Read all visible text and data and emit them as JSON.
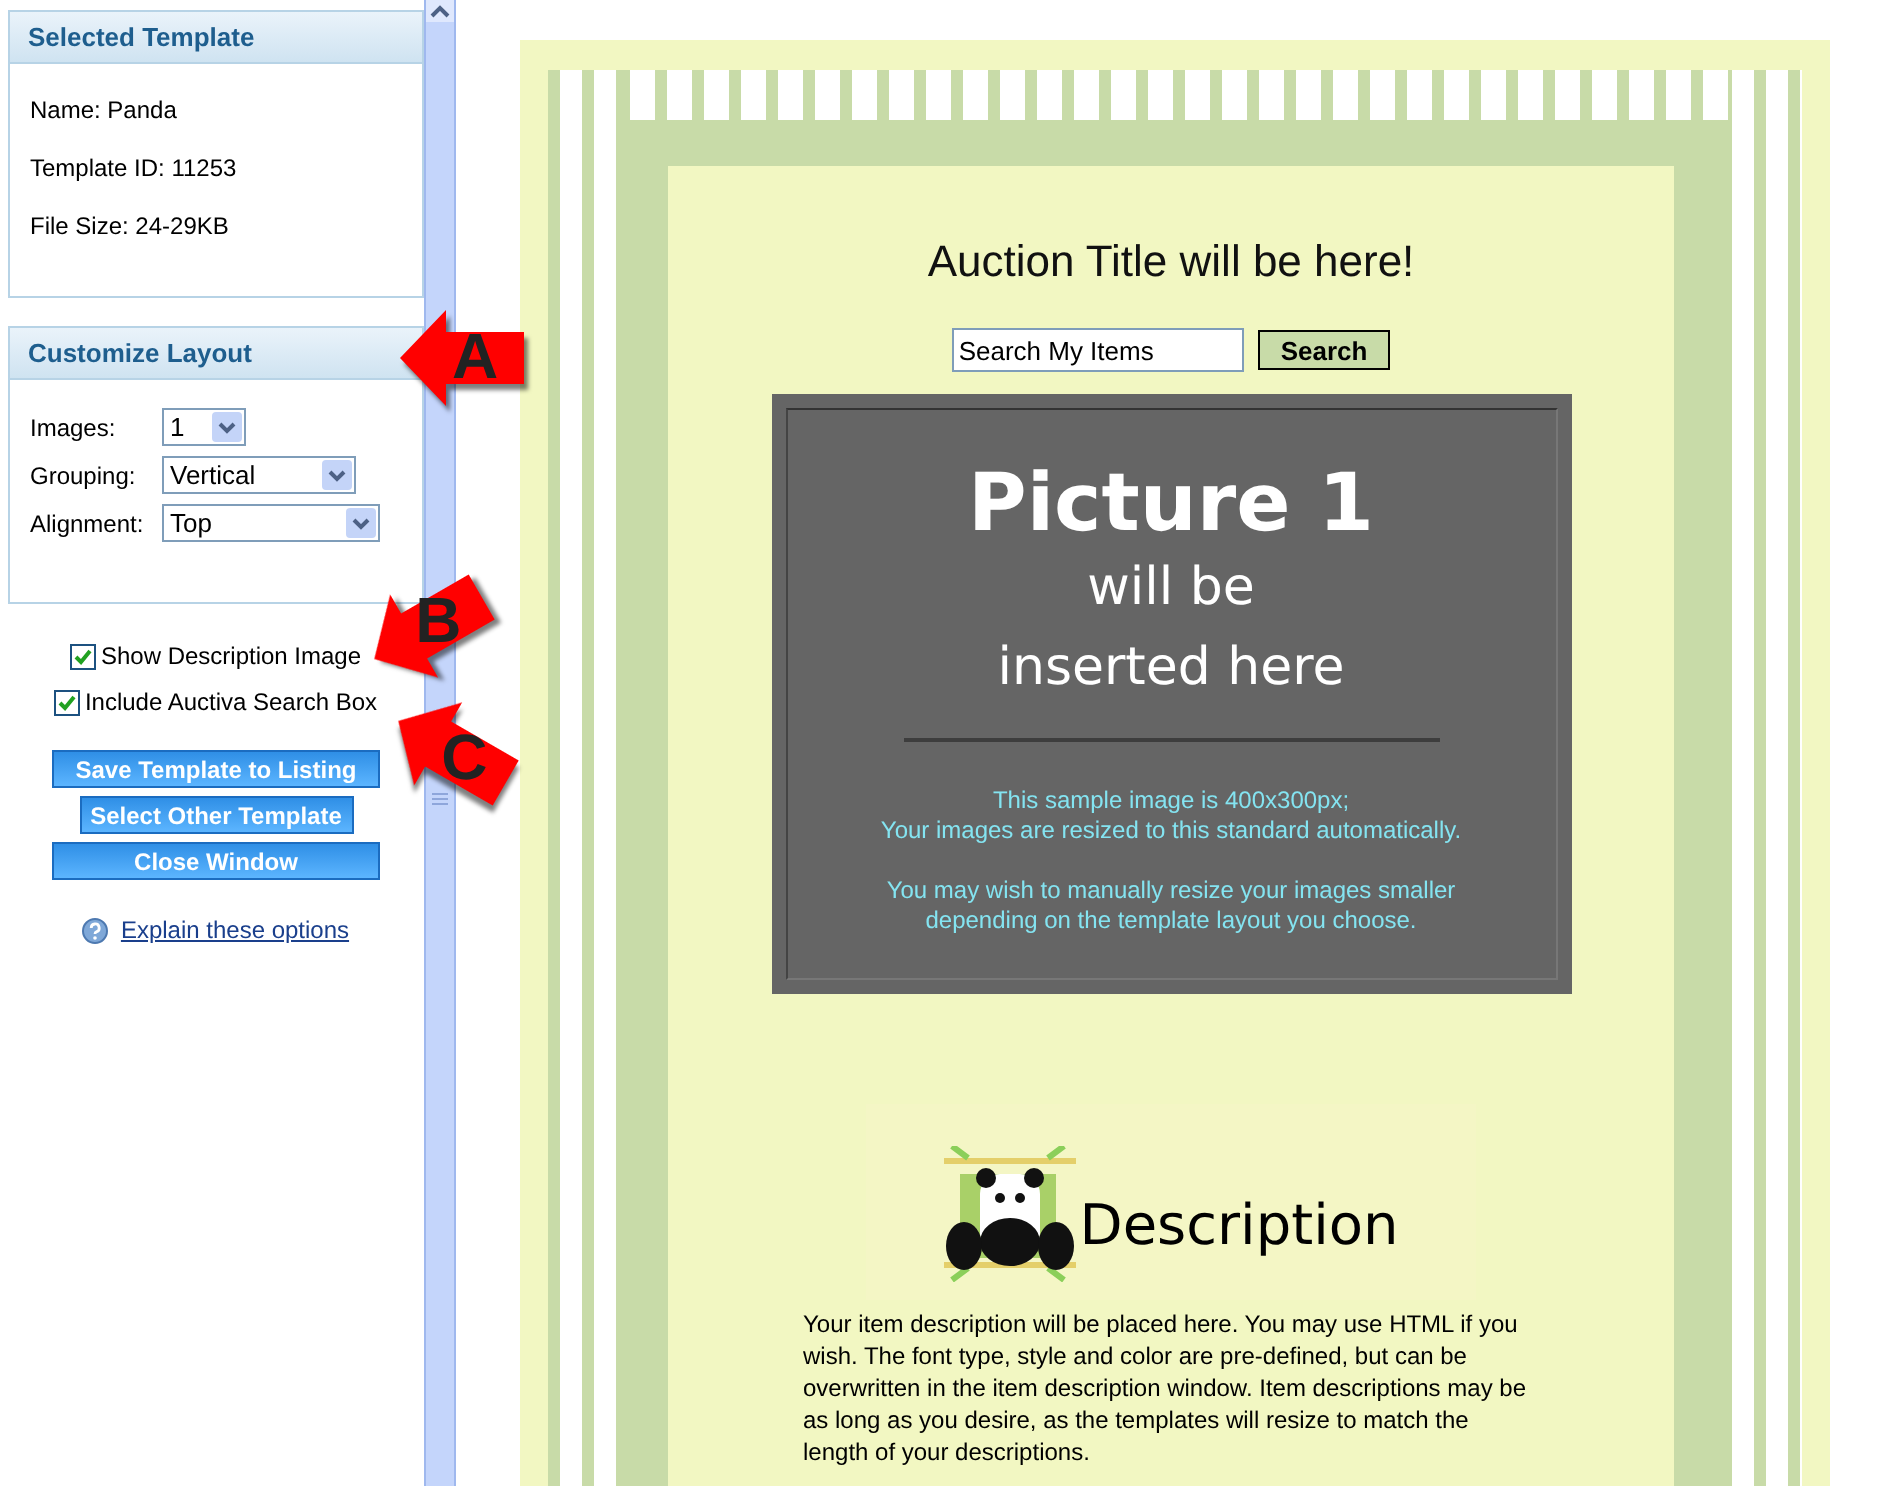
{
  "sidebar": {
    "selected_template": {
      "title": "Selected Template",
      "lines": [
        "Name: Panda",
        "Template ID: 11253",
        "File Size: 24-29KB"
      ]
    },
    "customize_layout": {
      "title": "Customize Layout",
      "fields": [
        {
          "label": "Images:",
          "value": "1"
        },
        {
          "label": "Grouping:",
          "value": "Vertical"
        },
        {
          "label": "Alignment:",
          "value": "Top"
        }
      ]
    },
    "options": [
      {
        "label": "Show Description Image",
        "checked": true
      },
      {
        "label": "Include Auctiva Search Box",
        "checked": true
      }
    ],
    "buttons": [
      "Save Template to Listing",
      "Select Other Template",
      "Close Window"
    ],
    "help_link": "Explain these options"
  },
  "callouts": [
    {
      "letter": "A"
    },
    {
      "letter": "B"
    },
    {
      "letter": "C"
    }
  ],
  "preview": {
    "auction_title": "Auction Title will be here!",
    "search": {
      "value": "Search My Items",
      "button": "Search"
    },
    "picture_placeholder": {
      "lines": [
        "Picture 1",
        "will be",
        "inserted here"
      ],
      "notes": [
        "This sample image is 400x300px;\nYour images are resized to this standard automatically.",
        "You may wish to manually resize your images smaller\ndepending on the template layout you choose."
      ]
    },
    "description": {
      "heading": "Description",
      "text": "Your item description will be placed here. You may use HTML if you wish. The font type, style and color are pre-defined, but can be overwritten in the item description window. Item descriptions may be as long as you desire, as the templates will resize to match the length of your descriptions."
    }
  }
}
